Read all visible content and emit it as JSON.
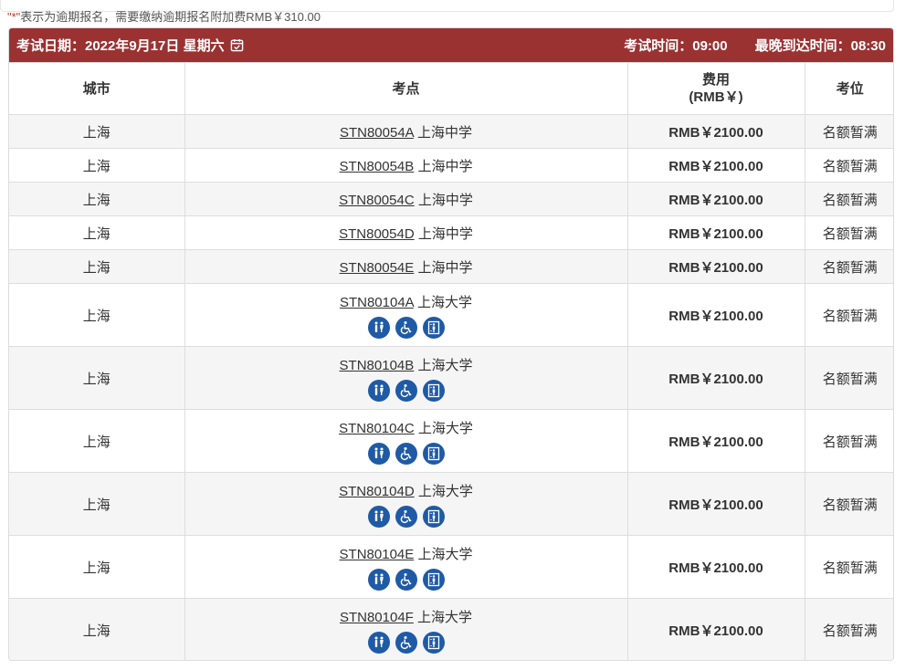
{
  "note": {
    "mark": "\"*\"",
    "text": "表示为逾期报名，需要缴纳逾期报名附加费RMB￥310.00"
  },
  "header": {
    "exam_date": "考试日期：2022年9月17日 星期六",
    "exam_time": "考试时间：09:00",
    "latest_arrival": "最晚到达时间：08:30"
  },
  "columns": {
    "city": "城市",
    "center": "考点",
    "fee_line1": "费用",
    "fee_line2": "(RMB￥)",
    "seats": "考位"
  },
  "rows": [
    {
      "city": "上海",
      "code": "STN80054A",
      "name": "上海中学",
      "fee": "RMB￥2100.00",
      "seats": "名额暂满",
      "icons": false
    },
    {
      "city": "上海",
      "code": "STN80054B",
      "name": "上海中学",
      "fee": "RMB￥2100.00",
      "seats": "名额暂满",
      "icons": false
    },
    {
      "city": "上海",
      "code": "STN80054C",
      "name": "上海中学",
      "fee": "RMB￥2100.00",
      "seats": "名额暂满",
      "icons": false
    },
    {
      "city": "上海",
      "code": "STN80054D",
      "name": "上海中学",
      "fee": "RMB￥2100.00",
      "seats": "名额暂满",
      "icons": false
    },
    {
      "city": "上海",
      "code": "STN80054E",
      "name": "上海中学",
      "fee": "RMB￥2100.00",
      "seats": "名额暂满",
      "icons": false
    },
    {
      "city": "上海",
      "code": "STN80104A",
      "name": "上海大学",
      "fee": "RMB￥2100.00",
      "seats": "名额暂满",
      "icons": true
    },
    {
      "city": "上海",
      "code": "STN80104B",
      "name": "上海大学",
      "fee": "RMB￥2100.00",
      "seats": "名额暂满",
      "icons": true
    },
    {
      "city": "上海",
      "code": "STN80104C",
      "name": "上海大学",
      "fee": "RMB￥2100.00",
      "seats": "名额暂满",
      "icons": true
    },
    {
      "city": "上海",
      "code": "STN80104D",
      "name": "上海大学",
      "fee": "RMB￥2100.00",
      "seats": "名额暂满",
      "icons": true
    },
    {
      "city": "上海",
      "code": "STN80104E",
      "name": "上海大学",
      "fee": "RMB￥2100.00",
      "seats": "名额暂满",
      "icons": true
    },
    {
      "city": "上海",
      "code": "STN80104F",
      "name": "上海大学",
      "fee": "RMB￥2100.00",
      "seats": "名额暂满",
      "icons": true
    }
  ],
  "facility_icons": [
    "restroom-icon",
    "wheelchair-icon",
    "elevator-icon"
  ],
  "colors": {
    "header_bg": "#9b3232",
    "icon_bg": "#1f5aa6",
    "note_mark": "#c0392b"
  }
}
